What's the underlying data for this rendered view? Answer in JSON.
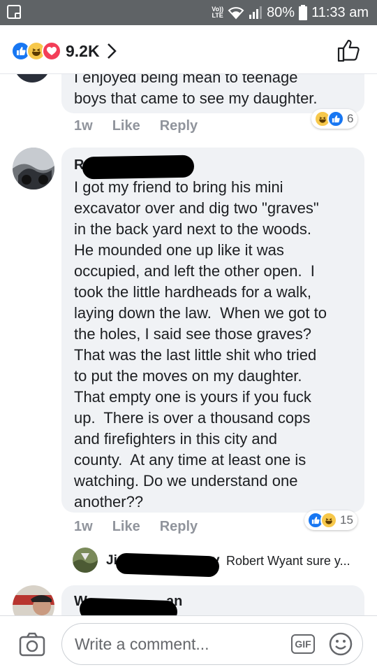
{
  "status_bar": {
    "volte_line1": "Vo))",
    "volte_line2": "LTE",
    "battery_percent": "80%",
    "time": "11:33 am",
    "background_color": "#5f6366"
  },
  "header": {
    "reactions": [
      "like-icon",
      "haha-icon",
      "love-icon"
    ],
    "reaction_count": "9.2K",
    "chevron_icon": "chevron-right-icon",
    "like_button_icon": "thumbs-up-icon"
  },
  "comments": [
    {
      "text": "I enjoyed being mean to teenage\nboys that came to see my daughter.",
      "time": "1w",
      "like_label": "Like",
      "reply_label": "Reply",
      "reactions": [
        "haha-icon",
        "like-icon"
      ],
      "reaction_count": "6"
    },
    {
      "author_visible": "R",
      "text": "I got my friend to bring his mini\nexcavator over and dig two \"graves\"\nin the back yard next to the woods.\nHe mounded one up like it was\noccupied, and left the other open.  I\ntook the little hardheads for a walk,\nlaying down the law.  When we got to\nthe holes, I said see those graves?\nThat was the last little shit who tried\nto put the moves on my daughter.\nThat empty one is yours if you fuck\nup.  There is over a thousand cops\nand firefighters in this city and\ncounty.  At any time at least one is\nwatching. Do we understand one\nanother??",
      "time": "1w",
      "like_label": "Like",
      "reply_label": "Reply",
      "reactions": [
        "like-icon",
        "haha-icon"
      ],
      "reaction_count": "15"
    }
  ],
  "reply_preview": {
    "author_visible_start": "Ji",
    "author_visible_end": "y",
    "preview_text": "Robert Wyant sure y..."
  },
  "next_comment": {
    "author_visible": "W",
    "author_visible_end": "an"
  },
  "footer": {
    "camera_icon": "camera-icon",
    "placeholder": "Write a comment...",
    "gif_label": "GIF",
    "emoji_icon": "smiley-icon"
  },
  "colors": {
    "facebook_blue": "#1877f2",
    "bubble_gray": "#f0f2f5",
    "meta_gray": "#90949c"
  }
}
